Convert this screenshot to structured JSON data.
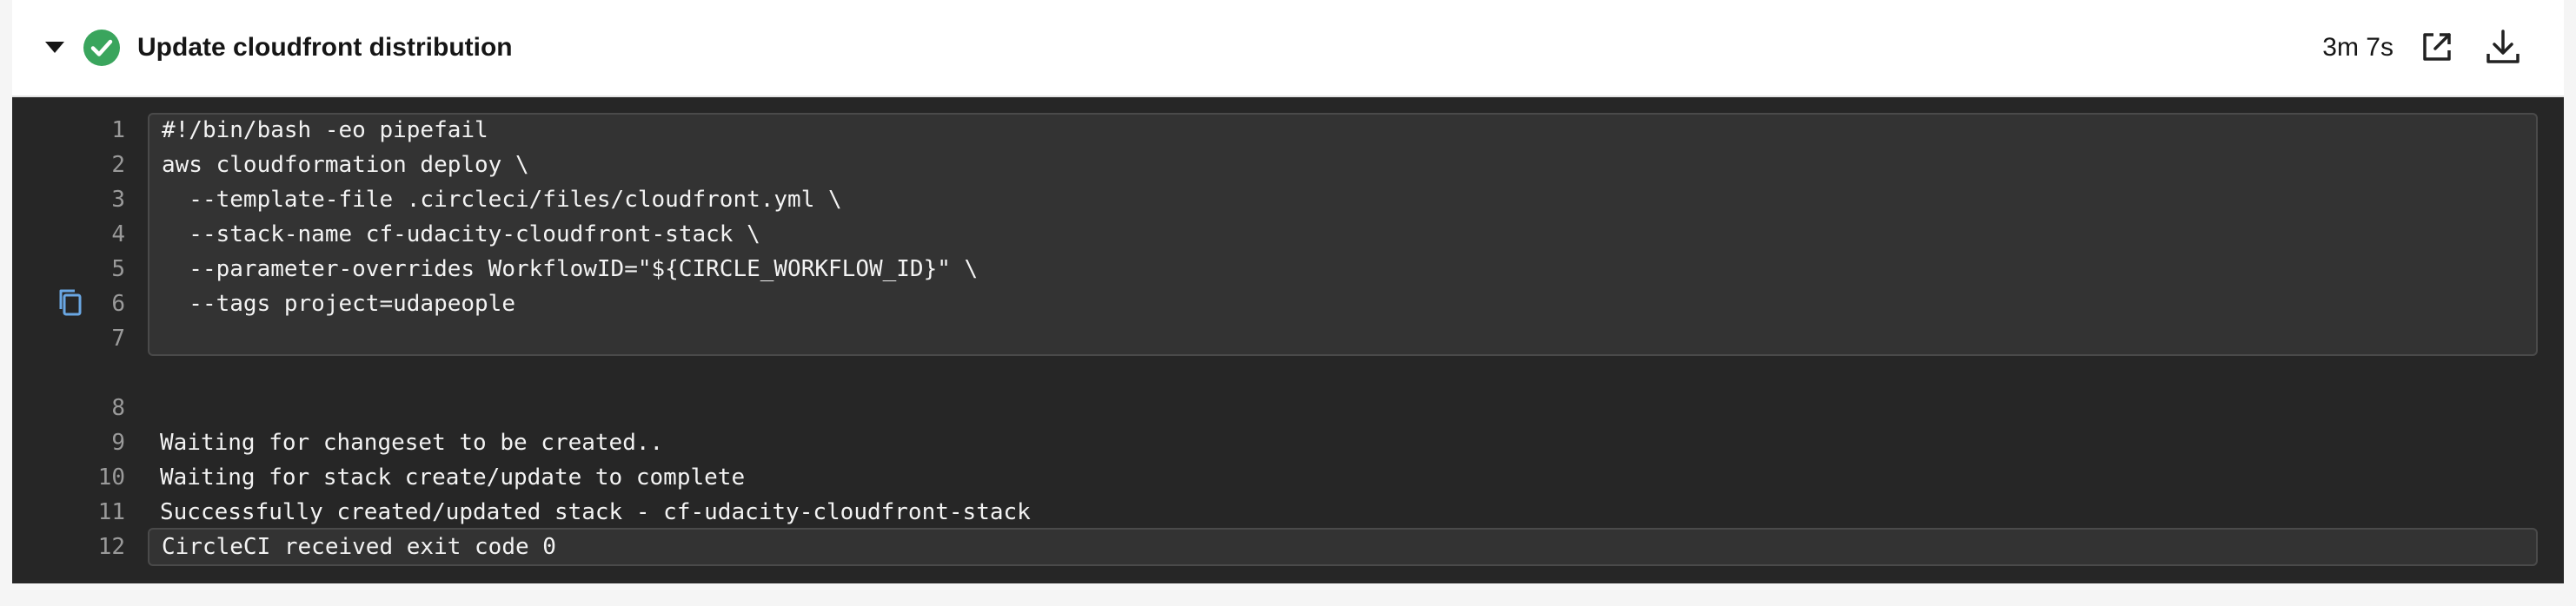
{
  "step": {
    "title": "Update cloudfront distribution",
    "duration": "3m 7s",
    "status": "success",
    "status_color": "#3aa55d"
  },
  "header_icons": {
    "collapse": "caret-down-icon",
    "status": "check-circle-icon",
    "open": "external-link-icon",
    "download": "download-icon"
  },
  "copy_icon": "copy-icon",
  "lines": [
    {
      "num": "1",
      "text": "#!/bin/bash -eo pipefail"
    },
    {
      "num": "2",
      "text": "aws cloudformation deploy \\"
    },
    {
      "num": "3",
      "text": "  --template-file .circleci/files/cloudfront.yml \\"
    },
    {
      "num": "4",
      "text": "  --stack-name cf-udacity-cloudfront-stack \\"
    },
    {
      "num": "5",
      "text": "  --parameter-overrides WorkflowID=\"${CIRCLE_WORKFLOW_ID}\" \\"
    },
    {
      "num": "6",
      "text": "  --tags project=udapeople"
    },
    {
      "num": "7",
      "text": ""
    },
    {
      "num": "8",
      "text": ""
    },
    {
      "num": "9",
      "text": "Waiting for changeset to be created.."
    },
    {
      "num": "10",
      "text": "Waiting for stack create/update to complete"
    },
    {
      "num": "11",
      "text": "Successfully created/updated stack - cf-udacity-cloudfront-stack"
    },
    {
      "num": "12",
      "text": "CircleCI received exit code 0"
    }
  ]
}
